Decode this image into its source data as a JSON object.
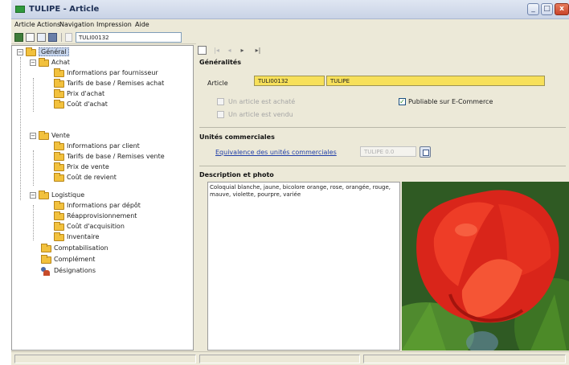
{
  "window": {
    "title": "TULIPE - Article",
    "controls": {
      "minimize": "_",
      "maximize": "□",
      "close": "x"
    }
  },
  "menubar": [
    "Article",
    "Actions",
    "Navigation",
    "Impression",
    "Aide"
  ],
  "toolbar": {
    "code_value": "TULI00132",
    "icons": [
      "app-icon",
      "new-icon",
      "open-icon",
      "save-icon",
      "delete-icon"
    ]
  },
  "tree": {
    "root": "Général",
    "achat": {
      "label": "Achat",
      "children": [
        "Informations par fournisseur",
        "Tarifs de base / Remises achat",
        "Prix d'achat",
        "Coût d'achat"
      ]
    },
    "vente": {
      "label": "Vente",
      "children": [
        "Informations par client",
        "Tarifs de base / Remises vente",
        "Prix de vente",
        "Coût de revient"
      ]
    },
    "logistique": {
      "label": "Logistique",
      "children": [
        "Informations par dépôt",
        "Réapprovisionnement",
        "Coût d'acquisition",
        "Inventaire"
      ]
    },
    "comptabilisation": "Comptabilisation",
    "complement": "Complément",
    "designations": "Désignations"
  },
  "nav": {
    "buttons": [
      "first-icon",
      "prev-icon",
      "next-icon",
      "last-icon"
    ],
    "glyphs": {
      "first": "|◂",
      "prev": "◂",
      "next": "▸",
      "last": "▸|"
    }
  },
  "generalites": {
    "title": "Généralités",
    "article_label": "Article",
    "article_code": "TULI00132",
    "article_name": "TULIPE",
    "checkbox_achat": "Un article est achaté",
    "checkbox_vente": "Un article est vendu",
    "checkbox_ecommerce": "Publiable sur E-Commerce",
    "ecommerce_checked": true
  },
  "unites": {
    "title": "Unités commerciales",
    "link": "Equivalence des unités commerciales",
    "value": "TULIPE 0.0"
  },
  "description": {
    "title": "Description et photo",
    "text": "Coloquial blanche, jaune, bicolore orange, rose, orangée, rouge, mauve, violette, pourpre, variée"
  },
  "colors": {
    "field_bg": "#f7e05a",
    "tree_selection": "#c7d6ee",
    "folder": "#f2c13d",
    "title_bar": "#dfe6f2"
  }
}
